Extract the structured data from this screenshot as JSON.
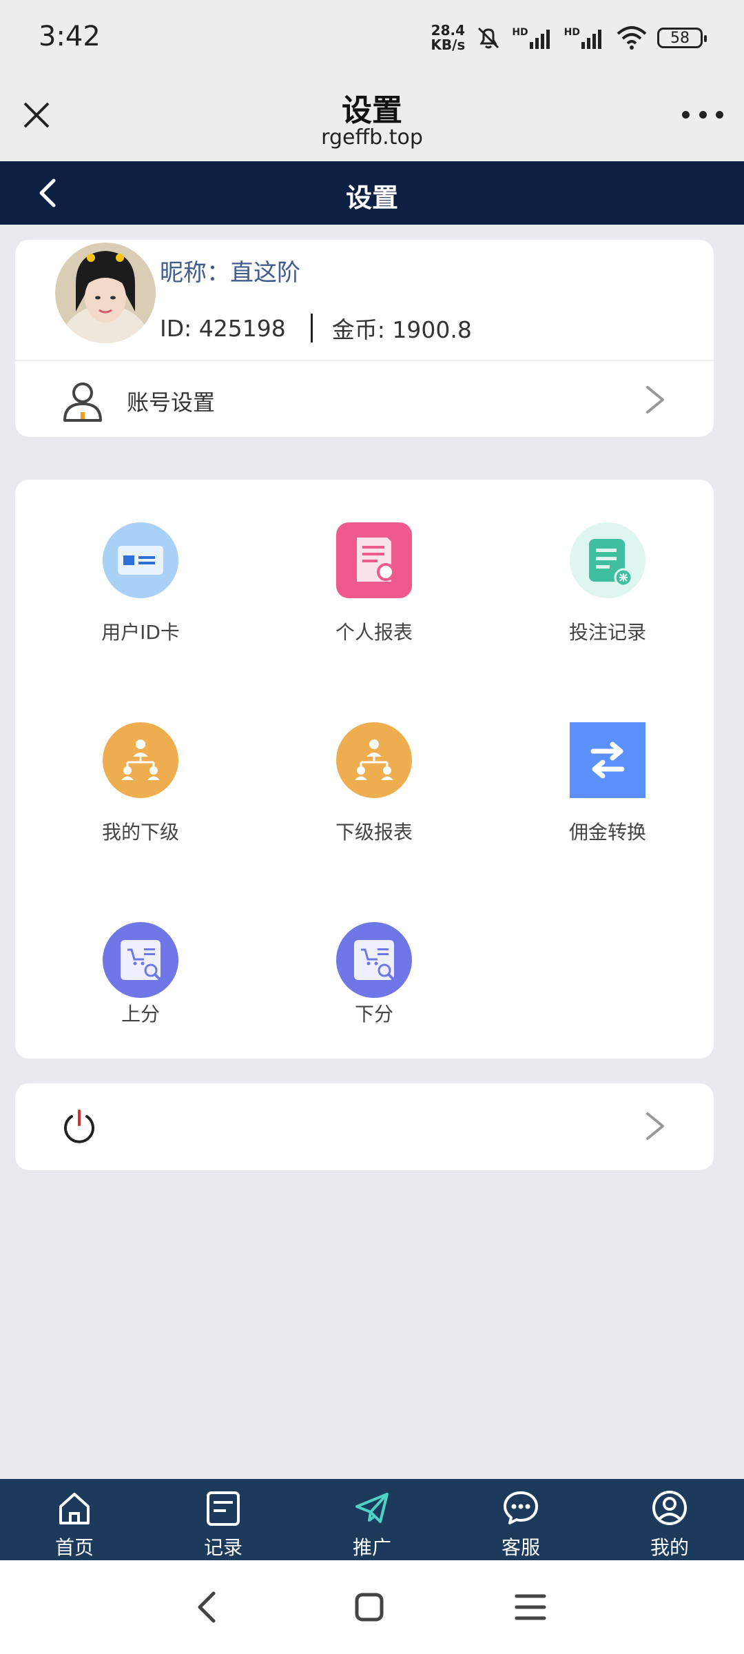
{
  "status_bar": {
    "time": "3:42",
    "net_speed_value": "28.4",
    "net_speed_unit": "KB/s",
    "hd1": "HD",
    "hd2": "HD",
    "battery": "58"
  },
  "browser": {
    "title": "设置",
    "url": "rgeffb.top"
  },
  "app_header": {
    "title": "设置"
  },
  "profile": {
    "nickname_label": "昵称：",
    "nickname": "直这阶",
    "id_text": "ID: 425198",
    "coins_text": "金币: 1900.8",
    "account_settings_label": "账号设置"
  },
  "grid": {
    "items": [
      {
        "label": "用户ID卡",
        "icon": "id-card-icon"
      },
      {
        "label": "个人报表",
        "icon": "report-search-icon"
      },
      {
        "label": "投注记录",
        "icon": "bet-record-icon"
      },
      {
        "label": "我的下级",
        "icon": "hierarchy-icon"
      },
      {
        "label": "下级报表",
        "icon": "hierarchy-icon"
      },
      {
        "label": "佣金转换",
        "icon": "swap-arrows-icon"
      },
      {
        "label": "上分",
        "icon": "cart-search-icon"
      },
      {
        "label": "下分",
        "icon": "cart-search-icon"
      }
    ]
  },
  "tabs": [
    {
      "label": "首页",
      "icon": "home-icon"
    },
    {
      "label": "记录",
      "icon": "document-icon"
    },
    {
      "label": "推广",
      "icon": "paper-plane-icon"
    },
    {
      "label": "客服",
      "icon": "chat-bubble-icon"
    },
    {
      "label": "我的",
      "icon": "user-circle-icon"
    }
  ],
  "colors": {
    "header_bg": "#0e1f44",
    "tab_bar_bg": "#1b3a5c",
    "active_tab_icon": "#4fd1c5",
    "nickname": "#3f5b8f",
    "orange_icon": "#eeae4f",
    "pink_icon": "#ee5a8e",
    "purple_icon": "#6f76e6",
    "blue_icon": "#5b8ff9"
  }
}
